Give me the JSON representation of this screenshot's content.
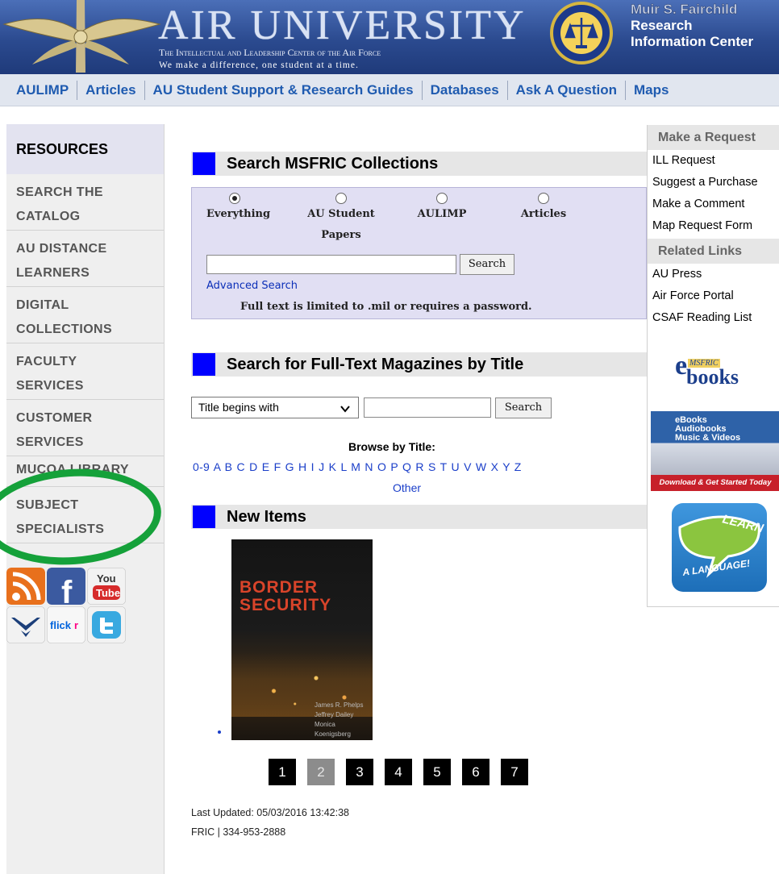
{
  "header": {
    "title": "AIR UNIVERSITY",
    "subtitle": "The Intellectual and Leadership Center of the Air Force",
    "tagline": "We make a difference, one student at a time.",
    "right_title_1": "Muir S. Fairchild",
    "right_title_2": "Research",
    "right_title_3": "Information Center"
  },
  "topnav": [
    "AULIMP",
    "Articles",
    "AU Student Support & Research Guides",
    "Databases",
    "Ask A Question",
    "Maps"
  ],
  "sidebar": {
    "heading": "RESOURCES",
    "items": [
      {
        "line1": "SEARCH THE",
        "line2": "CATALOG"
      },
      {
        "line1": "AU DISTANCE",
        "line2": "LEARNERS"
      },
      {
        "line1": "DIGITAL",
        "line2": "COLLECTIONS"
      },
      {
        "line1": "FACULTY",
        "line2": "SERVICES"
      },
      {
        "line1": "CUSTOMER",
        "line2": "SERVICES"
      },
      {
        "line1": "MUCOA LIBRARY",
        "line2": ""
      },
      {
        "line1": "SUBJECT",
        "line2": "SPECIALISTS"
      }
    ],
    "social": [
      "rss-icon",
      "facebook-icon",
      "youtube-icon",
      "air-force-icon",
      "flickr-icon",
      "twitter-icon"
    ]
  },
  "search": {
    "heading": "Search MSFRIC Collections",
    "options": [
      {
        "label_1": "Everything",
        "label_2": "",
        "selected": true
      },
      {
        "label_1": "AU Student",
        "label_2": "Papers",
        "selected": false
      },
      {
        "label_1": "AULIMP",
        "label_2": "",
        "selected": false
      },
      {
        "label_1": "Articles",
        "label_2": "",
        "selected": false
      }
    ],
    "query": "",
    "button": "Search",
    "advanced": "Advanced Search",
    "note": "Full text is limited to .mil or requires a password."
  },
  "magazines": {
    "heading": "Search for Full-Text Magazines by Title",
    "select_value": "Title begins with",
    "query": "",
    "button": "Search",
    "browse_heading": "Browse by Title:",
    "letters": [
      "0-9",
      "A",
      "B",
      "C",
      "D",
      "E",
      "F",
      "G",
      "H",
      "I",
      "J",
      "K",
      "L",
      "M",
      "N",
      "O",
      "P",
      "Q",
      "R",
      "S",
      "T",
      "U",
      "V",
      "W",
      "X",
      "Y",
      "Z"
    ],
    "other": "Other"
  },
  "new_items": {
    "heading": "New Items",
    "book_title_1": "BORDER",
    "book_title_2": "SECURITY",
    "authors": [
      "James R. Phelps",
      "Jeffrey Dailey",
      "Monica Koenigsberg"
    ],
    "pages": [
      "1",
      "2",
      "3",
      "4",
      "5",
      "6",
      "7"
    ],
    "current_page": "2"
  },
  "footer": {
    "updated": "Last Updated: 05/03/2016 13:42:38",
    "contact": "FRIC | 334-953-2888"
  },
  "right": {
    "request_heading": "Make a Request",
    "request_links": [
      "ILL Request",
      "Suggest a Purchase",
      "Make a Comment",
      "Map Request Form"
    ],
    "related_heading": "Related Links",
    "related_links": [
      "AU Press",
      "Air Force Portal",
      "CSAF Reading List"
    ],
    "ebooks_logo_small": "MSFRIC",
    "ebooks_logo_big": "books",
    "ebooks_banner_lines": [
      "eBooks",
      "Audiobooks",
      "Music & Videos"
    ],
    "ebooks_banner_bottom": "Download & Get Started Today",
    "learn_1": "LEARN",
    "learn_2": "A LANGUAGE!"
  },
  "colors": {
    "nav_link": "#1f5bb0",
    "section_square": "#0000ff",
    "annotation_circle": "#15a13a"
  }
}
